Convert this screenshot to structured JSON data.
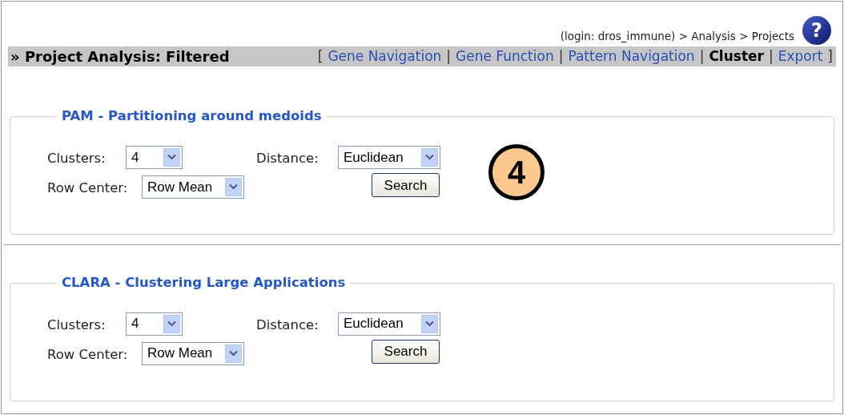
{
  "help_button": "?",
  "breadcrumb": "(login: dros_immune) > Analysis > Projects",
  "title": "» Project Analysis: Filtered",
  "nav_open": "[",
  "nav_separator": "|",
  "nav_close": "]",
  "nav": [
    {
      "label": "Gene Navigation",
      "selected": false
    },
    {
      "label": "Gene Function",
      "selected": false
    },
    {
      "label": "Pattern Navigation",
      "selected": false
    },
    {
      "label": "Cluster",
      "selected": true
    },
    {
      "label": "Export",
      "selected": false
    }
  ],
  "callout": "4",
  "sections": [
    {
      "legend": "PAM - Partitioning around medoids",
      "clusters_label": "Clusters:",
      "clusters_value": "4",
      "distance_label": "Distance:",
      "distance_value": "Euclidean",
      "row_center_label": "Row Center:",
      "row_center_value": "Row Mean",
      "button": "Search"
    },
    {
      "legend": "CLARA - Clustering Large Applications",
      "clusters_label": "Clusters:",
      "clusters_value": "4",
      "distance_label": "Distance:",
      "distance_value": "Euclidean",
      "row_center_label": "Row Center:",
      "row_center_value": "Row Mean",
      "button": "Search"
    }
  ]
}
